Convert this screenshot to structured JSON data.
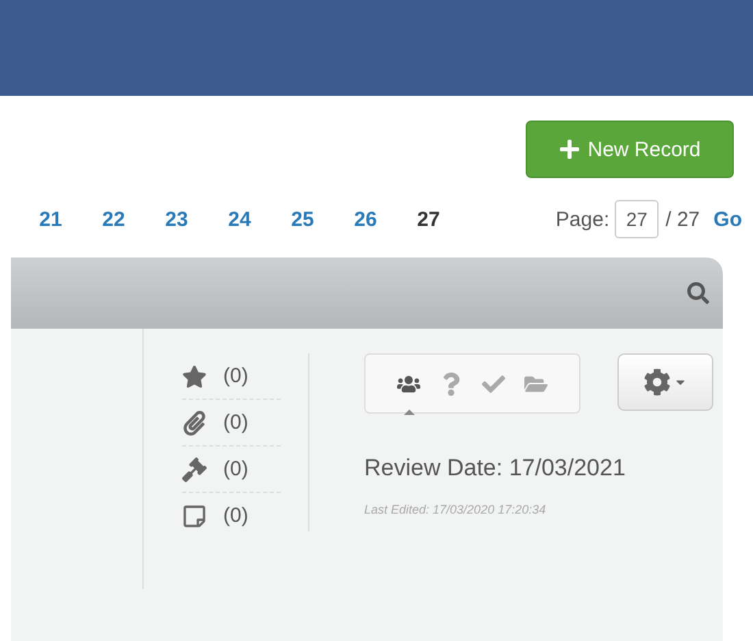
{
  "new_record_button": {
    "label": "New Record"
  },
  "pagination": {
    "pages": [
      {
        "label": "21",
        "selected": false
      },
      {
        "label": "22",
        "selected": false
      },
      {
        "label": "23",
        "selected": false
      },
      {
        "label": "24",
        "selected": false
      },
      {
        "label": "25",
        "selected": false
      },
      {
        "label": "26",
        "selected": false
      },
      {
        "label": "27",
        "selected": true
      }
    ],
    "page_label": "Page:",
    "page_value": "27",
    "total": "/ 27",
    "go": "Go"
  },
  "counters": [
    {
      "kind": "star",
      "count": "(0)"
    },
    {
      "kind": "paperclip",
      "count": "(0)"
    },
    {
      "kind": "gavel",
      "count": "(0)"
    },
    {
      "kind": "note",
      "count": "(0)"
    }
  ],
  "tabs": [
    {
      "kind": "group",
      "selected": true
    },
    {
      "kind": "question",
      "selected": false
    },
    {
      "kind": "check",
      "selected": false
    },
    {
      "kind": "folder",
      "selected": false
    }
  ],
  "review_date": "Review Date: 17/03/2021",
  "last_edited": "Last Edited: 17/03/2020 17:20:34"
}
